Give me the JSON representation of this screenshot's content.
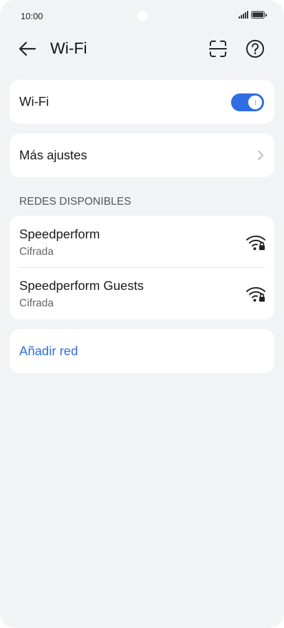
{
  "status_bar": {
    "time": "10:00"
  },
  "header": {
    "title": "Wi-Fi"
  },
  "wifi_toggle": {
    "label": "Wi-Fi",
    "enabled": true
  },
  "more_settings": {
    "label": "Más ajustes"
  },
  "available_networks": {
    "header": "REDES DISPONIBLES",
    "items": [
      {
        "name": "Speedperform",
        "security": "Cifrada"
      },
      {
        "name": "Speedperform Guests",
        "security": "Cifrada"
      }
    ]
  },
  "add_network": {
    "label": "Añadir red"
  },
  "colors": {
    "accent": "#2f6de3",
    "background": "#f1f3f5",
    "card": "#ffffff"
  }
}
